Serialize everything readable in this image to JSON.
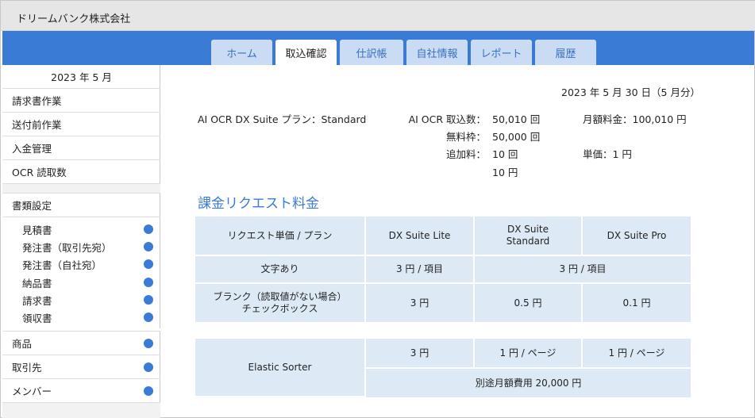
{
  "company": "ドリームバンク株式会社",
  "colors": {
    "accent": "#3a7bd5",
    "tab_bg": "#c9dcf4",
    "table_bg": "#ddeaf6"
  },
  "tabs": [
    {
      "label": "ホーム",
      "active": false
    },
    {
      "label": "取込確認",
      "active": true
    },
    {
      "label": "仕訳帳",
      "active": false
    },
    {
      "label": "自社情報",
      "active": false
    },
    {
      "label": "レポート",
      "active": false
    },
    {
      "label": "履歴",
      "active": false
    }
  ],
  "sidebar": {
    "period": "2023 年 5 月",
    "items": [
      "請求書作業",
      "送付前作業",
      "入金管理",
      "OCR 読取数"
    ],
    "doc_settings": {
      "label": "書類設定",
      "children": [
        "見積書",
        "発注書（取引先宛）",
        "発注書（自社宛）",
        "納品書",
        "請求書",
        "領収書"
      ]
    },
    "bottom_items": [
      "商品",
      "取引先",
      "メンバー"
    ]
  },
  "summary": {
    "date": "2023 年 5 月 30 日（5 月分）",
    "plan": "AI OCR DX Suite プラン：Standard",
    "import_label": "AI OCR 取込数：",
    "import_value": "50,010 回",
    "free_label": "無料枠：",
    "free_value": "50,000 回",
    "extra_label": "追加料：",
    "extra_count": "10 回",
    "extra_yen": "10 円",
    "monthly_fee": "月額料金：100,010 円",
    "unit_price": "単価：1 円"
  },
  "section_title": "課金リクエスト料金",
  "pricing_table": {
    "headers": [
      "リクエスト単価 / プラン",
      "DX Suite Lite",
      "DX Suite\nStandard",
      "DX Suite Pro"
    ],
    "rows": [
      {
        "label": "文字あり",
        "lite": "3 円 / 項目",
        "std_pro": "3 円 / 項目"
      },
      {
        "label": "ブランク（読取値がない場合）\nチェックボックス",
        "lite": "3 円",
        "std": "0.5 円",
        "pro": "0.1 円"
      }
    ]
  },
  "sorter_table": {
    "label": "Elastic Sorter",
    "lite": "3 円",
    "std": "1 円 / ページ",
    "pro": "1 円 / ページ",
    "note": "別途月額費用 20,000 円"
  }
}
